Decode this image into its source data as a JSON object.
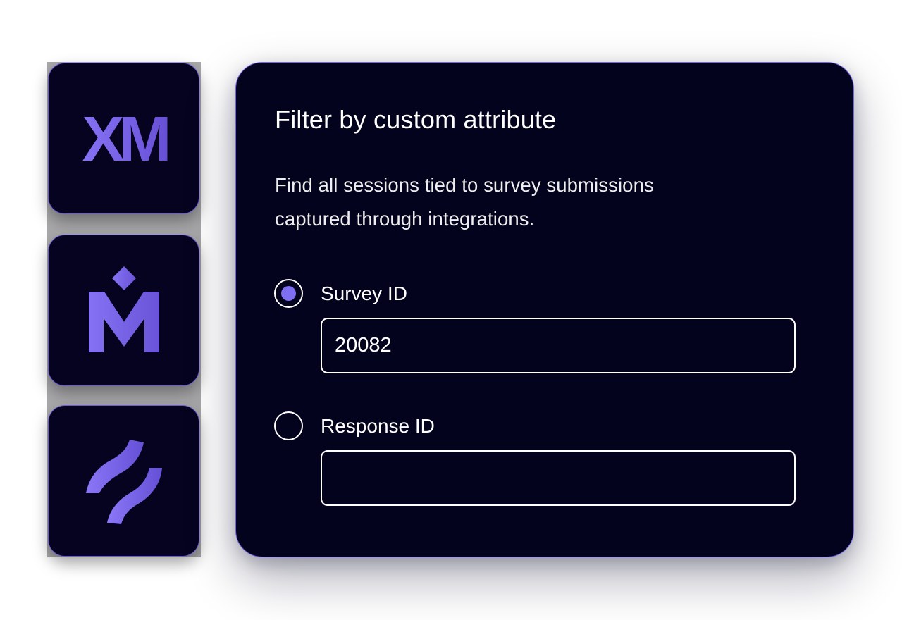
{
  "integrations": [
    {
      "name": "xm-logo-icon"
    },
    {
      "name": "m-diamond-logo-icon"
    },
    {
      "name": "wave-logo-icon"
    }
  ],
  "logos": {
    "xm_text": "XM"
  },
  "card": {
    "title": "Filter by custom attribute",
    "description": "Find all sessions tied to survey submissions captured through integrations."
  },
  "options": [
    {
      "label": "Survey ID",
      "selected": true,
      "value": "20082",
      "placeholder": ""
    },
    {
      "label": "Response ID",
      "selected": false,
      "value": "",
      "placeholder": ""
    }
  ],
  "colors": {
    "background": "#ffffff",
    "card_bg": "#04031d",
    "card_border": "#7664e6",
    "accent": "#7d6ef2",
    "text": "#ffffff"
  }
}
